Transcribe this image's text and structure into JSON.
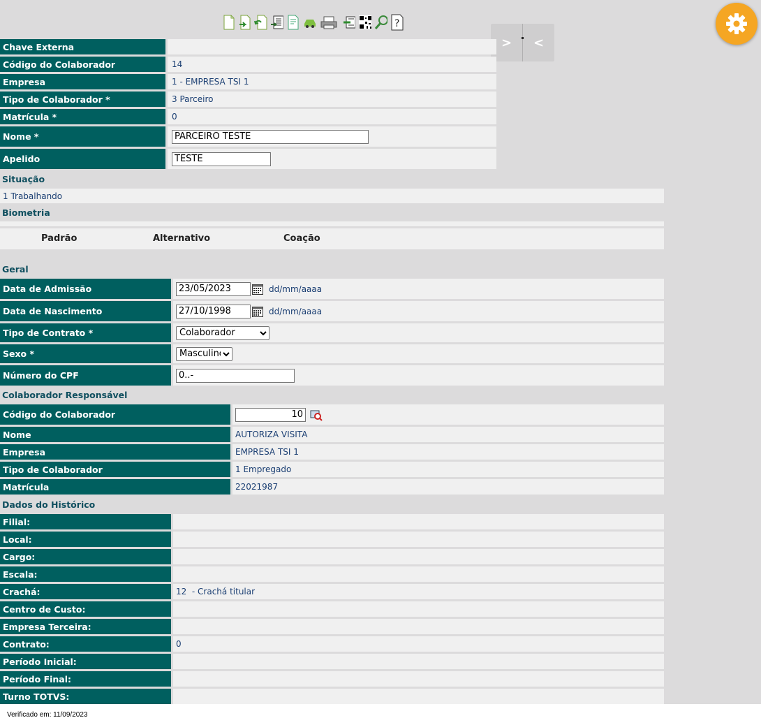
{
  "toolbar": {
    "icons": [
      "new-document-icon",
      "export-icon",
      "undo-icon",
      "report-icon",
      "edit-document-icon",
      "car-icon",
      "printer-icon",
      "scanner-icon",
      "qr-code-icon",
      "search-icon",
      "help-icon"
    ]
  },
  "nav": {
    "next": ">",
    "prev": "<"
  },
  "top_fields": [
    {
      "label": "Chave Externa",
      "value": ""
    },
    {
      "label": "Código do Colaborador",
      "value": "14"
    },
    {
      "label": "Empresa",
      "value": "1 - EMPRESA TSI 1"
    },
    {
      "label": "Tipo de Colaborador *",
      "value": "3 Parceiro"
    },
    {
      "label": "Matrícula *",
      "value": "0"
    }
  ],
  "nome": {
    "label": "Nome *",
    "value": "PARCEIRO TESTE"
  },
  "apelido": {
    "label": "Apelido",
    "value": "TESTE"
  },
  "situacao": {
    "title": "Situação",
    "value": "1 Trabalhando"
  },
  "biometria": {
    "title": "Biometria",
    "cols": [
      "Padrão",
      "Alternativo",
      "Coação"
    ]
  },
  "geral": {
    "title": "Geral",
    "admissao": {
      "label": "Data de Admissão",
      "value": "23/05/2023",
      "hint": "dd/mm/aaaa"
    },
    "nascimento": {
      "label": "Data de Nascimento",
      "value": "27/10/1998",
      "hint": "dd/mm/aaaa"
    },
    "contrato": {
      "label": "Tipo de Contrato *",
      "value": "Colaborador"
    },
    "sexo": {
      "label": "Sexo *",
      "value": "Masculino"
    },
    "cpf": {
      "label": "Número do CPF",
      "value": "0..-"
    }
  },
  "responsavel": {
    "title": "Colaborador Responsável",
    "codigo": {
      "label": "Código do Colaborador",
      "value": "10"
    },
    "fields": [
      {
        "label": "Nome",
        "value": "AUTORIZA VISITA"
      },
      {
        "label": "Empresa",
        "value": "EMPRESA TSI 1"
      },
      {
        "label": "Tipo de Colaborador",
        "value": "1 Empregado"
      },
      {
        "label": "Matrícula",
        "value": "22021987"
      }
    ]
  },
  "historico": {
    "title": "Dados do Histórico",
    "fields": [
      {
        "label": "Filial:",
        "value": ""
      },
      {
        "label": "Local:",
        "value": ""
      },
      {
        "label": "Cargo:",
        "value": ""
      },
      {
        "label": "Escala:",
        "value": ""
      },
      {
        "label": "Crachá:",
        "value": "12  - Crachá titular"
      },
      {
        "label": "Centro de Custo:",
        "value": ""
      },
      {
        "label": "Empresa Terceira:",
        "value": ""
      },
      {
        "label": "Contrato:",
        "value": "0"
      },
      {
        "label": "Período Inicial:",
        "value": ""
      },
      {
        "label": "Período Final:",
        "value": ""
      },
      {
        "label": "Turno TOTVS:",
        "value": ""
      }
    ]
  },
  "footer": {
    "text": "Verificado em: 11/09/2023"
  }
}
